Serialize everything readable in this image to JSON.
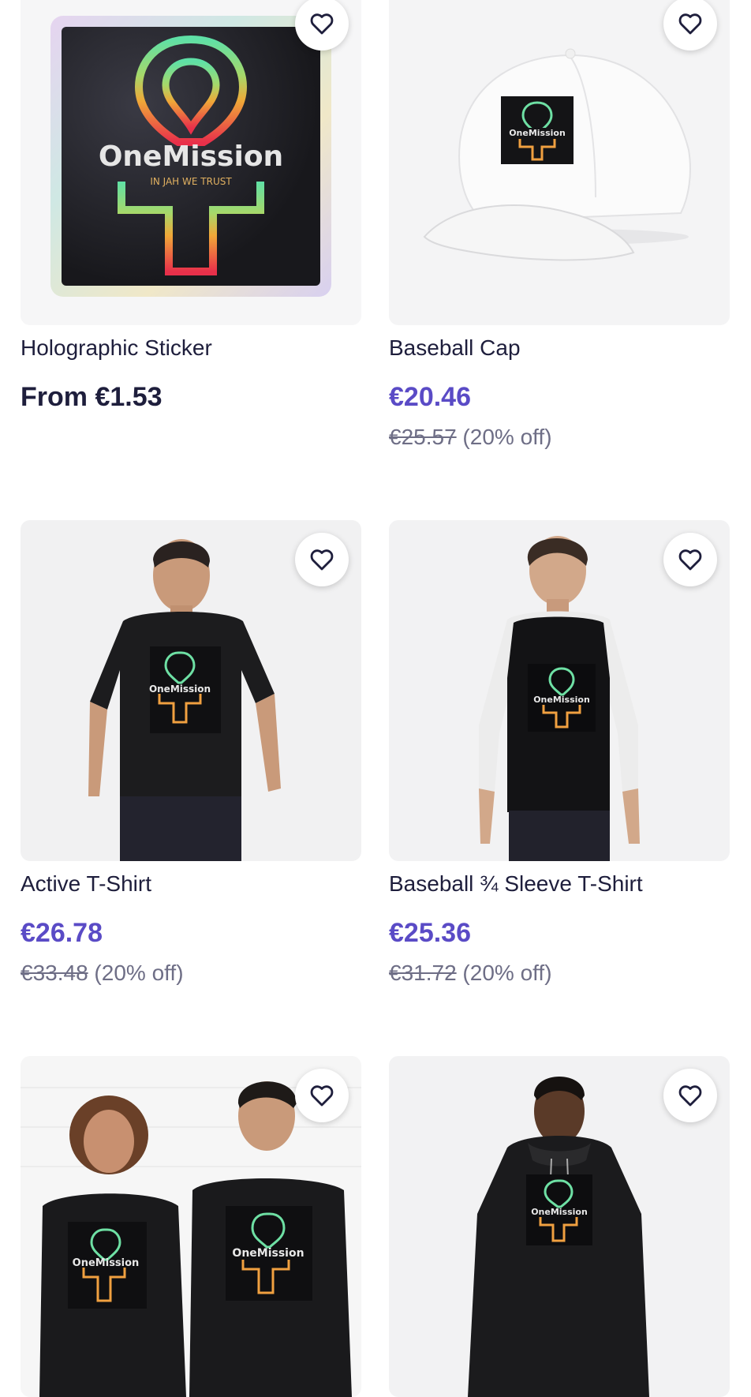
{
  "products": [
    {
      "title": "Holographic Sticker",
      "price": "From €1.53",
      "price_style": "plain",
      "original_price": "",
      "discount": "",
      "image_icon": "holographic-sticker-image"
    },
    {
      "title": "Baseball Cap",
      "price": "€20.46",
      "price_style": "sale",
      "original_price": "€25.57",
      "discount": "(20% off)",
      "image_icon": "baseball-cap-image"
    },
    {
      "title": "Active T-Shirt",
      "price": "€26.78",
      "price_style": "sale",
      "original_price": "€33.48",
      "discount": "(20% off)",
      "image_icon": "active-tshirt-image"
    },
    {
      "title": "Baseball ¾ Sleeve T-Shirt",
      "price": "€25.36",
      "price_style": "sale",
      "original_price": "€31.72",
      "discount": "(20% off)",
      "image_icon": "baseball-sleeve-tshirt-image"
    },
    {
      "title": "",
      "price": "",
      "image_icon": "classic-tshirt-image"
    },
    {
      "title": "",
      "price": "",
      "image_icon": "hoodie-image"
    }
  ],
  "logo": {
    "brand": "OneMission",
    "tagline": "IN JAH WE TRUST"
  },
  "colors": {
    "sale_price": "#5a4bc6",
    "text": "#1e1e3c",
    "muted": "#6e6e86"
  },
  "icons": {
    "favorite": "heart-outline-icon"
  }
}
